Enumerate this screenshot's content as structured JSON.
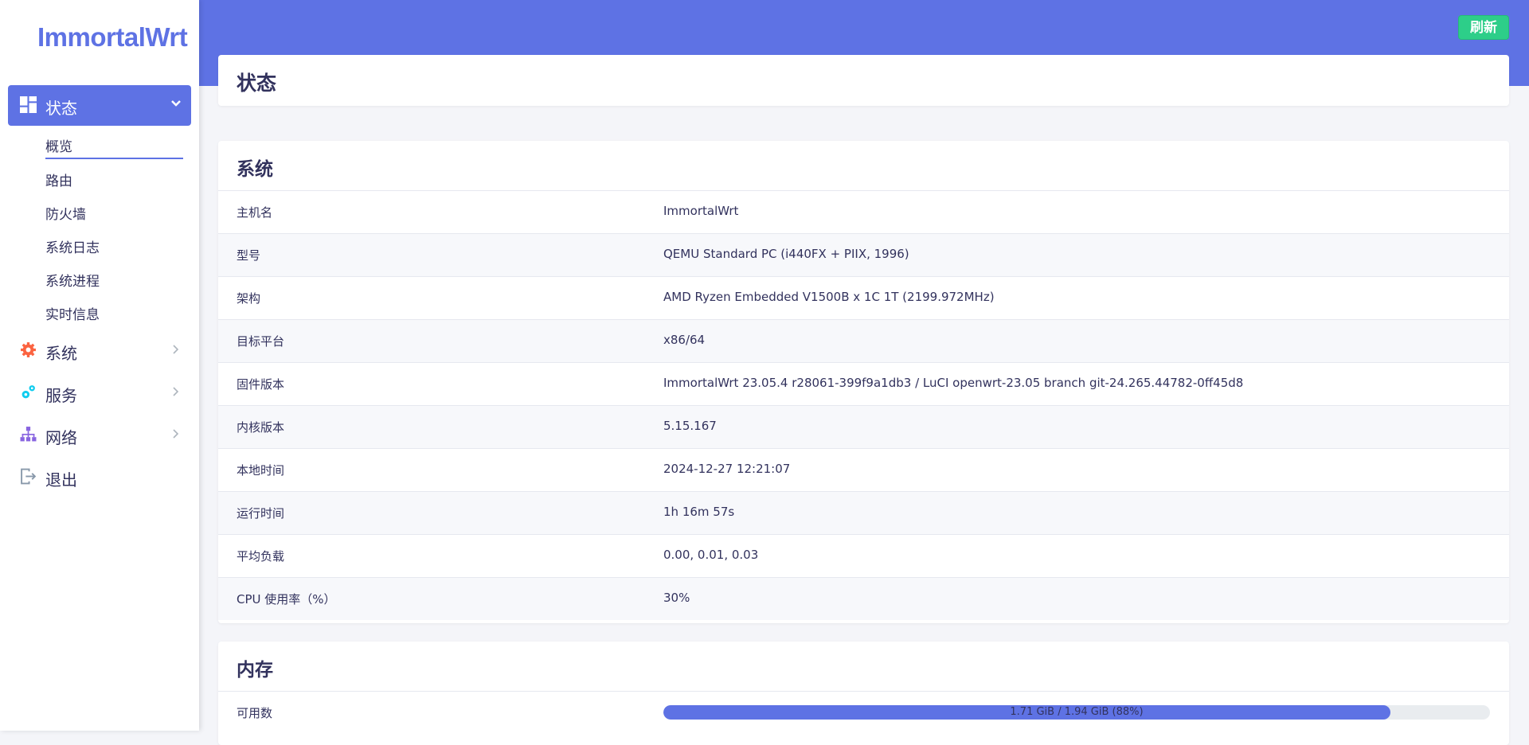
{
  "app": {
    "logo": "ImmortalWrt",
    "refresh_label": "刷新"
  },
  "colors": {
    "accent": "#5e72e4",
    "success": "#2dce89",
    "gear_icon": "#fb6340",
    "services_icon": "#11cdef",
    "network_icon": "#8965e0"
  },
  "sidebar": {
    "active": {
      "label": "状态",
      "icon": "dashboard-icon"
    },
    "subitems": [
      "概览",
      "路由",
      "防火墙",
      "系统日志",
      "系统进程",
      "实时信息"
    ],
    "items": [
      {
        "label": "系统",
        "icon": "gear-icon"
      },
      {
        "label": "服务",
        "icon": "services-icon"
      },
      {
        "label": "网络",
        "icon": "network-icon"
      },
      {
        "label": "退出",
        "icon": "logout-icon"
      }
    ]
  },
  "page": {
    "title": "状态"
  },
  "system": {
    "heading": "系统",
    "rows": [
      {
        "key": "主机名",
        "value": "ImmortalWrt"
      },
      {
        "key": "型号",
        "value": "QEMU Standard PC (i440FX + PIIX, 1996)"
      },
      {
        "key": "架构",
        "value": "AMD Ryzen Embedded V1500B x 1C 1T (2199.972MHz)"
      },
      {
        "key": "目标平台",
        "value": "x86/64"
      },
      {
        "key": "固件版本",
        "value": "ImmortalWrt 23.05.4 r28061-399f9a1db3 / LuCI openwrt-23.05 branch git-24.265.44782-0ff45d8"
      },
      {
        "key": "内核版本",
        "value": "5.15.167"
      },
      {
        "key": "本地时间",
        "value": "2024-12-27 12:21:07"
      },
      {
        "key": "运行时间",
        "value": "1h 16m 57s"
      },
      {
        "key": "平均负载",
        "value": "0.00, 0.01, 0.03"
      },
      {
        "key": "CPU 使用率（%）",
        "value": "30%"
      }
    ]
  },
  "memory": {
    "heading": "内存",
    "rows": [
      {
        "key": "可用数",
        "bar_text": "1.71 GiB / 1.94 GiB (88%)",
        "percent": 88
      }
    ]
  }
}
